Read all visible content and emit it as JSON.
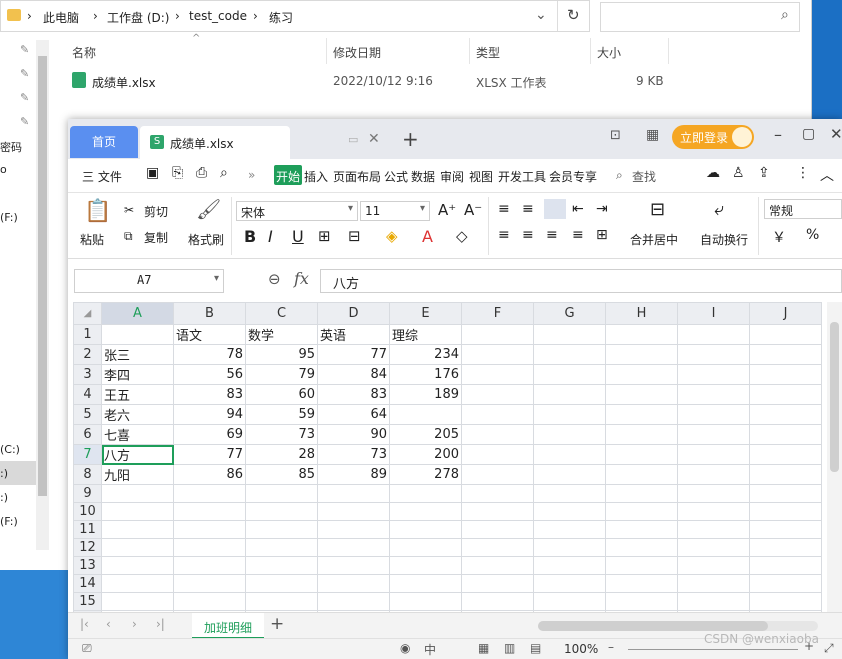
{
  "explorer": {
    "breadcrumb": [
      "此电脑",
      "工作盘 (D:)",
      "test_code",
      "练习"
    ],
    "columns": [
      "名称",
      "修改日期",
      "类型",
      "大小"
    ],
    "file": {
      "name": "成绩单.xlsx",
      "date": "2022/10/12 9:16",
      "type": "XLSX 工作表",
      "size": "9 KB"
    },
    "nav_items": [
      "密码",
      "o",
      "(F:)",
      "(C:)",
      ":)",
      ":)",
      "(F:)"
    ]
  },
  "wps": {
    "home_tab": "首页",
    "doc_tab": "成绩单.xlsx",
    "login": "立即登录",
    "menu": {
      "file": "三 文件",
      "more": "»",
      "items": [
        "开始",
        "插入",
        "页面布局",
        "公式",
        "数据",
        "审阅",
        "视图",
        "开发工具",
        "会员专享"
      ],
      "search": "查找"
    },
    "ribbon": {
      "paste": "粘贴",
      "cut": "剪切",
      "copy": "复制",
      "format_painter": "格式刷",
      "font": "宋体",
      "size": "11",
      "merge": "合并居中",
      "wrap": "自动换行",
      "numfmt": "常规",
      "percent": "%"
    },
    "formula": {
      "cellref": "A7",
      "fx": "fx",
      "content": "八方"
    },
    "sheet": {
      "columns": [
        "A",
        "B",
        "C",
        "D",
        "E",
        "F",
        "G",
        "H",
        "I",
        "J"
      ],
      "rows": [
        [
          "",
          "语文",
          "数学",
          "英语",
          "理综"
        ],
        [
          "张三",
          "78",
          "95",
          "77",
          "234"
        ],
        [
          "李四",
          "56",
          "79",
          "84",
          "176"
        ],
        [
          "王五",
          "83",
          "60",
          "83",
          "189"
        ],
        [
          "老六",
          "94",
          "59",
          "64",
          ""
        ],
        [
          "七喜",
          "69",
          "73",
          "90",
          "205"
        ],
        [
          "八方",
          "77",
          "28",
          "73",
          "200"
        ],
        [
          "九阳",
          "86",
          "85",
          "89",
          "278"
        ],
        [
          "",
          "",
          "",
          "",
          ""
        ],
        [
          "",
          "",
          "",
          "",
          ""
        ],
        [
          "",
          "",
          "",
          "",
          ""
        ],
        [
          "",
          "",
          "",
          "",
          ""
        ],
        [
          "",
          "",
          "",
          "",
          ""
        ],
        [
          "",
          "",
          "",
          "",
          ""
        ],
        [
          "",
          "",
          "",
          "",
          ""
        ],
        [
          "",
          "",
          "",
          "",
          ""
        ]
      ],
      "tab": "加班明细"
    },
    "zoom": "100%",
    "watermark": "CSDN @wenxiaoba"
  }
}
